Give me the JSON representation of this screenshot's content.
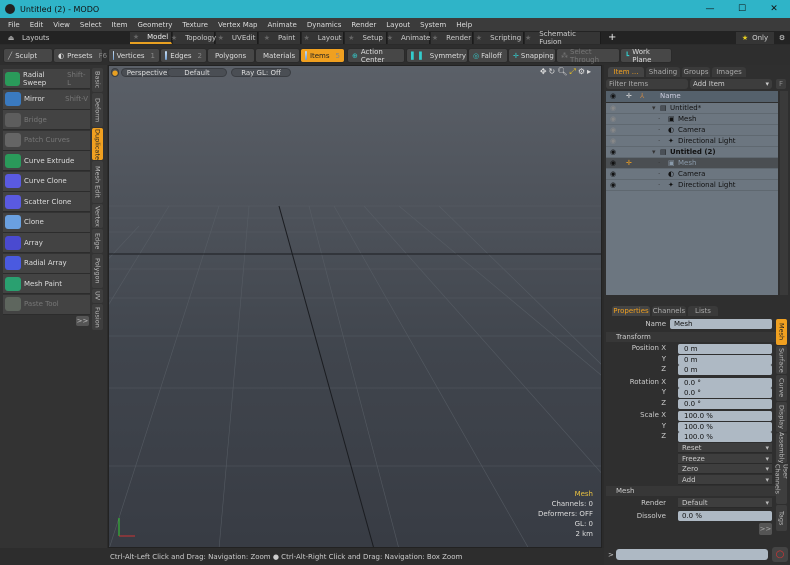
{
  "window": {
    "title": "Untitled (2) - MODO",
    "minimize": "—",
    "maximize": "☐",
    "close": "✕"
  },
  "menu": [
    "File",
    "Edit",
    "View",
    "Select",
    "Item",
    "Geometry",
    "Texture",
    "Vertex Map",
    "Animate",
    "Dynamics",
    "Render",
    "Layout",
    "System",
    "Help"
  ],
  "layouts": {
    "label": "Layouts",
    "tabs": [
      "Model",
      "Topology",
      "UVEdit",
      "Paint",
      "Layout",
      "Setup",
      "Animate",
      "Render",
      "Scripting",
      "Schematic Fusion"
    ],
    "active": "Model",
    "add": "+",
    "only": "Only"
  },
  "toolbar": {
    "sculpt": "Sculpt",
    "presets": "Presets",
    "presets_key": "F6",
    "modes": [
      {
        "label": "Vertices",
        "key": "1"
      },
      {
        "label": "Edges",
        "key": "2"
      },
      {
        "label": "Polygons",
        "key": ""
      },
      {
        "label": "Materials",
        "key": ""
      },
      {
        "label": "Items",
        "key": "5"
      }
    ],
    "action_center": "Action Center",
    "symmetry": "Symmetry",
    "falloff": "Falloff",
    "snapping": "Snapping",
    "select_through": "Select Through",
    "work_plane": "Work Plane"
  },
  "tools": [
    {
      "label": "Radial Sweep",
      "shortcut": "Shift-L",
      "enabled": true
    },
    {
      "label": "Mirror",
      "shortcut": "Shift-V",
      "enabled": true
    },
    {
      "label": "Bridge",
      "shortcut": "",
      "enabled": false
    },
    {
      "label": "Patch Curves",
      "shortcut": "",
      "enabled": false
    },
    {
      "label": "Curve Extrude",
      "shortcut": "",
      "enabled": true
    },
    {
      "label": "Curve Clone",
      "shortcut": "",
      "enabled": true
    },
    {
      "label": "Scatter Clone",
      "shortcut": "",
      "enabled": true
    },
    {
      "label": "Clone",
      "shortcut": "",
      "enabled": true
    },
    {
      "label": "Array",
      "shortcut": "",
      "enabled": true
    },
    {
      "label": "Radial Array",
      "shortcut": "",
      "enabled": true
    },
    {
      "label": "Mesh Paint",
      "shortcut": "",
      "enabled": true
    },
    {
      "label": "Paste Tool",
      "shortcut": "",
      "enabled": false
    }
  ],
  "tool_tabs": [
    "Basic",
    "Deform",
    "Duplicate",
    "Mesh Edit",
    "Vertex",
    "Edge",
    "Polygon",
    "UV",
    "Fusion"
  ],
  "tool_tab_active": "Duplicate",
  "expand": ">>",
  "viewport": {
    "view": "Perspective",
    "shading": "Default",
    "render": "Ray GL: Off",
    "info": {
      "item": "Mesh",
      "channels": "Channels: 0",
      "deformers": "Deformers: OFF",
      "gl": "GL: 0",
      "scale": "2 km"
    }
  },
  "status": "Ctrl-Alt-Left Click and Drag: Navigation: Zoom ● Ctrl-Alt-Right Click and Drag: Navigation: Box Zoom",
  "itemlist": {
    "tabs": [
      "Item ...",
      "Shading",
      "Groups",
      "Images"
    ],
    "filter": "Filter Items",
    "add_item": "Add Item",
    "f": "F",
    "col_name": "Name",
    "rows": [
      {
        "name": "Untitled*",
        "indent": 0,
        "bold": false,
        "vis": false
      },
      {
        "name": "Mesh",
        "indent": 1,
        "vis": true
      },
      {
        "name": "Camera",
        "indent": 1,
        "vis": true
      },
      {
        "name": "Directional Light",
        "indent": 1,
        "vis": true
      },
      {
        "name": "Untitled (2)",
        "indent": 0,
        "bold": true,
        "vis": true
      },
      {
        "name": "Mesh",
        "indent": 1,
        "selected": true,
        "vis": true
      },
      {
        "name": "Camera",
        "indent": 1,
        "vis": true
      },
      {
        "name": "Directional Light",
        "indent": 1,
        "vis": true
      }
    ]
  },
  "properties": {
    "tabs": [
      "Properties",
      "Channels",
      "Lists"
    ],
    "name_label": "Name",
    "name": "Mesh",
    "transform": "Transform",
    "fields": [
      {
        "label": "Position X",
        "value": "0 m"
      },
      {
        "label": "Y",
        "value": "0 m"
      },
      {
        "label": "Z",
        "value": "0 m"
      },
      {
        "label": "Rotation X",
        "value": "0.0 °"
      },
      {
        "label": "Y",
        "value": "0.0 °"
      },
      {
        "label": "Z",
        "value": "0.0 °"
      },
      {
        "label": "Scale X",
        "value": "100.0 %"
      },
      {
        "label": "Y",
        "value": "100.0 %"
      },
      {
        "label": "Z",
        "value": "100.0 %"
      }
    ],
    "actions": [
      "Reset",
      "Freeze",
      "Zero",
      "Add"
    ],
    "mesh_section": "Mesh",
    "render_label": "Render",
    "render": "Default",
    "dissolve_label": "Dissolve",
    "dissolve": "0.0 %",
    "side_tabs": [
      "Mesh",
      "Surface",
      "Curve",
      "Display",
      "Assembly",
      "User Channels",
      "Tags"
    ],
    "expand": ">>"
  },
  "command": {
    "prompt": ">",
    "value": ""
  },
  "colors": {
    "accent": "#f0a020",
    "titlebar": "#2fb4c8"
  }
}
